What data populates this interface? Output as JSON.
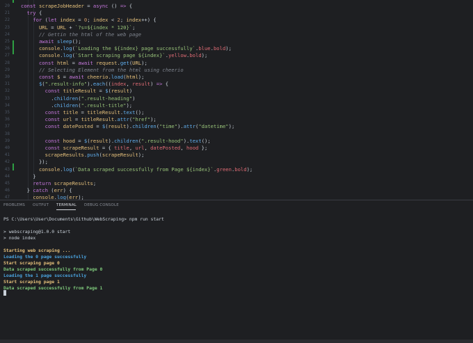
{
  "editor": {
    "lines": [
      {
        "num": "20",
        "tokens": [
          [
            "kw",
            "const "
          ],
          [
            "var",
            "scrapeJobHeader"
          ],
          [
            "pl",
            " = "
          ],
          [
            "kw",
            "async"
          ],
          [
            "pl",
            " () "
          ],
          [
            "kw",
            "=>"
          ],
          [
            "pl",
            " {"
          ]
        ]
      },
      {
        "num": "21",
        "tokens": [
          [
            "pl",
            "  "
          ],
          [
            "kw",
            "try"
          ],
          [
            "pl",
            " {"
          ]
        ]
      },
      {
        "num": "22",
        "tokens": [
          [
            "pl",
            "    "
          ],
          [
            "kw",
            "for"
          ],
          [
            "pl",
            " ("
          ],
          [
            "kw",
            "let "
          ],
          [
            "var",
            "index"
          ],
          [
            "pl",
            " = "
          ],
          [
            "num",
            "0"
          ],
          [
            "pl",
            "; "
          ],
          [
            "var",
            "index"
          ],
          [
            "pl",
            " < "
          ],
          [
            "num",
            "2"
          ],
          [
            "pl",
            "; "
          ],
          [
            "var",
            "index"
          ],
          [
            "pl",
            "++) {"
          ]
        ]
      },
      {
        "num": "23",
        "tokens": [
          [
            "pl",
            "      "
          ],
          [
            "var",
            "URL"
          ],
          [
            "pl",
            " = "
          ],
          [
            "var",
            "URL"
          ],
          [
            "pl",
            " + "
          ],
          [
            "str",
            "`?s=${index * 120}`"
          ],
          [
            "pl",
            ";"
          ]
        ]
      },
      {
        "num": "24",
        "tokens": [
          [
            "pl",
            "      "
          ],
          [
            "cm",
            "// Gettin the html of the web page"
          ]
        ]
      },
      {
        "num": "25",
        "tokens": [
          [
            "pl",
            "      "
          ],
          [
            "kw",
            "await "
          ],
          [
            "fn",
            "sleep"
          ],
          [
            "pl",
            "();"
          ]
        ]
      },
      {
        "num": "26",
        "tokens": [
          [
            "pl",
            "      "
          ],
          [
            "var",
            "console"
          ],
          [
            "pl",
            "."
          ],
          [
            "fn",
            "log"
          ],
          [
            "pl",
            "("
          ],
          [
            "str",
            "`Loading the ${index} page successfully`"
          ],
          [
            "pl",
            "."
          ],
          [
            "pr",
            "blue"
          ],
          [
            "pl",
            "."
          ],
          [
            "pr",
            "bold"
          ],
          [
            "pl",
            ");"
          ]
        ]
      },
      {
        "num": "27",
        "tokens": [
          [
            "pl",
            "      "
          ],
          [
            "var",
            "console"
          ],
          [
            "pl",
            "."
          ],
          [
            "fn",
            "log"
          ],
          [
            "pl",
            "("
          ],
          [
            "str",
            "`Start scraping page ${index}`"
          ],
          [
            "pl",
            "."
          ],
          [
            "pr",
            "yellow"
          ],
          [
            "pl",
            "."
          ],
          [
            "pr",
            "bold"
          ],
          [
            "pl",
            ");"
          ]
        ]
      },
      {
        "num": "28",
        "tokens": [
          [
            "pl",
            "      "
          ],
          [
            "kw",
            "const "
          ],
          [
            "var",
            "html"
          ],
          [
            "pl",
            " = "
          ],
          [
            "kw",
            "await "
          ],
          [
            "var",
            "request"
          ],
          [
            "pl",
            "."
          ],
          [
            "fn",
            "get"
          ],
          [
            "pl",
            "("
          ],
          [
            "var",
            "URL"
          ],
          [
            "pl",
            ");"
          ]
        ]
      },
      {
        "num": "29",
        "tokens": [
          [
            "pl",
            "      "
          ],
          [
            "cm",
            "// Selecting Element from the html using cheerio"
          ]
        ]
      },
      {
        "num": "30",
        "tokens": [
          [
            "pl",
            "      "
          ],
          [
            "kw",
            "const "
          ],
          [
            "var",
            "$"
          ],
          [
            "pl",
            " = "
          ],
          [
            "kw",
            "await "
          ],
          [
            "var",
            "cheerio"
          ],
          [
            "pl",
            "."
          ],
          [
            "fn",
            "load"
          ],
          [
            "pl",
            "("
          ],
          [
            "var",
            "html"
          ],
          [
            "pl",
            ");"
          ]
        ]
      },
      {
        "num": "31",
        "tokens": [
          [
            "pl",
            "      "
          ],
          [
            "fn",
            "$"
          ],
          [
            "pl",
            "("
          ],
          [
            "str",
            "\".result-info\""
          ],
          [
            "pl",
            ")."
          ],
          [
            "fn",
            "each"
          ],
          [
            "pl",
            "(("
          ],
          [
            "pr",
            "index"
          ],
          [
            "pl",
            ", "
          ],
          [
            "pr",
            "result"
          ],
          [
            "pl",
            ") "
          ],
          [
            "kw",
            "=>"
          ],
          [
            "pl",
            " {"
          ]
        ]
      },
      {
        "num": "32",
        "tokens": [
          [
            "pl",
            "        "
          ],
          [
            "kw",
            "const "
          ],
          [
            "var",
            "titleResult"
          ],
          [
            "pl",
            " = "
          ],
          [
            "fn",
            "$"
          ],
          [
            "pl",
            "("
          ],
          [
            "var",
            "result"
          ],
          [
            "pl",
            ")"
          ]
        ]
      },
      {
        "num": "33",
        "tokens": [
          [
            "pl",
            "          ."
          ],
          [
            "fn",
            "children"
          ],
          [
            "pl",
            "("
          ],
          [
            "str",
            "\".result-heading\""
          ],
          [
            "pl",
            ")"
          ]
        ]
      },
      {
        "num": "34",
        "tokens": [
          [
            "pl",
            "          ."
          ],
          [
            "fn",
            "children"
          ],
          [
            "pl",
            "("
          ],
          [
            "str",
            "\".result-title\""
          ],
          [
            "pl",
            ");"
          ]
        ]
      },
      {
        "num": "35",
        "tokens": [
          [
            "pl",
            "        "
          ],
          [
            "kw",
            "const "
          ],
          [
            "var",
            "title"
          ],
          [
            "pl",
            " = "
          ],
          [
            "var",
            "titleResult"
          ],
          [
            "pl",
            "."
          ],
          [
            "fn",
            "text"
          ],
          [
            "pl",
            "();"
          ]
        ]
      },
      {
        "num": "36",
        "tokens": [
          [
            "pl",
            "        "
          ],
          [
            "kw",
            "const "
          ],
          [
            "var",
            "url"
          ],
          [
            "pl",
            " = "
          ],
          [
            "var",
            "titleResult"
          ],
          [
            "pl",
            "."
          ],
          [
            "fn",
            "attr"
          ],
          [
            "pl",
            "("
          ],
          [
            "str",
            "\"href\""
          ],
          [
            "pl",
            ");"
          ]
        ]
      },
      {
        "num": "37",
        "tokens": [
          [
            "pl",
            "        "
          ],
          [
            "kw",
            "const "
          ],
          [
            "var",
            "datePosted"
          ],
          [
            "pl",
            " = "
          ],
          [
            "fn",
            "$"
          ],
          [
            "pl",
            "("
          ],
          [
            "var",
            "result"
          ],
          [
            "pl",
            ")."
          ],
          [
            "fn",
            "children"
          ],
          [
            "pl",
            "("
          ],
          [
            "str",
            "\"time\""
          ],
          [
            "pl",
            ")."
          ],
          [
            "fn",
            "attr"
          ],
          [
            "pl",
            "("
          ],
          [
            "str",
            "\"datetime\""
          ],
          [
            "pl",
            ");"
          ]
        ]
      },
      {
        "num": "38",
        "tokens": []
      },
      {
        "num": "39",
        "tokens": [
          [
            "pl",
            "        "
          ],
          [
            "kw",
            "const "
          ],
          [
            "var",
            "hood"
          ],
          [
            "pl",
            " = "
          ],
          [
            "fn",
            "$"
          ],
          [
            "pl",
            "("
          ],
          [
            "var",
            "result"
          ],
          [
            "pl",
            ")."
          ],
          [
            "fn",
            "children"
          ],
          [
            "pl",
            "("
          ],
          [
            "str",
            "\".result-hood\""
          ],
          [
            "pl",
            ")."
          ],
          [
            "fn",
            "text"
          ],
          [
            "pl",
            "();"
          ]
        ]
      },
      {
        "num": "40",
        "tokens": [
          [
            "pl",
            "        "
          ],
          [
            "kw",
            "const "
          ],
          [
            "var",
            "scrapeResult"
          ],
          [
            "pl",
            " = { "
          ],
          [
            "pr",
            "title"
          ],
          [
            "pl",
            ", "
          ],
          [
            "pr",
            "url"
          ],
          [
            "pl",
            ", "
          ],
          [
            "pr",
            "datePosted"
          ],
          [
            "pl",
            ", "
          ],
          [
            "pr",
            "hood"
          ],
          [
            "pl",
            " };"
          ]
        ]
      },
      {
        "num": "41",
        "tokens": [
          [
            "pl",
            "        "
          ],
          [
            "var",
            "scrapeResults"
          ],
          [
            "pl",
            "."
          ],
          [
            "fn",
            "push"
          ],
          [
            "pl",
            "("
          ],
          [
            "var",
            "scrapeResult"
          ],
          [
            "pl",
            ");"
          ]
        ]
      },
      {
        "num": "42",
        "tokens": [
          [
            "pl",
            "      });"
          ]
        ]
      },
      {
        "num": "43",
        "tokens": [
          [
            "pl",
            "      "
          ],
          [
            "var",
            "console"
          ],
          [
            "pl",
            "."
          ],
          [
            "fn",
            "log"
          ],
          [
            "pl",
            "("
          ],
          [
            "str",
            "`Data scraped successfully from Page ${index}`"
          ],
          [
            "pl",
            "."
          ],
          [
            "pr",
            "green"
          ],
          [
            "pl",
            "."
          ],
          [
            "pr",
            "bold"
          ],
          [
            "pl",
            ");"
          ]
        ]
      },
      {
        "num": "44",
        "tokens": [
          [
            "pl",
            "    }"
          ]
        ]
      },
      {
        "num": "45",
        "tokens": [
          [
            "pl",
            "    "
          ],
          [
            "kw",
            "return "
          ],
          [
            "var",
            "scrapeResults"
          ],
          [
            "pl",
            ";"
          ]
        ]
      },
      {
        "num": "46",
        "tokens": [
          [
            "pl",
            "  } "
          ],
          [
            "kw",
            "catch"
          ],
          [
            "pl",
            " ("
          ],
          [
            "var",
            "err"
          ],
          [
            "pl",
            ") {"
          ]
        ]
      },
      {
        "num": "47",
        "tokens": [
          [
            "pl",
            "    "
          ],
          [
            "var",
            "console"
          ],
          [
            "pl",
            "."
          ],
          [
            "fn",
            "log"
          ],
          [
            "pl",
            "("
          ],
          [
            "var",
            "err"
          ],
          [
            "pl",
            ");"
          ]
        ]
      }
    ]
  },
  "panel": {
    "tabs": [
      {
        "label": "PROBLEMS",
        "active": false
      },
      {
        "label": "OUTPUT",
        "active": false
      },
      {
        "label": "TERMINAL",
        "active": true
      },
      {
        "label": "DEBUG CONSOLE",
        "active": false
      }
    ]
  },
  "terminal": {
    "lines": [
      {
        "text": "PS C:\\Users\\User\\Documents\\Github\\WebScraping> npm run start",
        "style": "t-plain"
      },
      {
        "text": "",
        "style": "t-plain"
      },
      {
        "text": "> webscraping@1.0.0 start",
        "style": "t-plain"
      },
      {
        "text": "> node index",
        "style": "t-plain"
      },
      {
        "text": "",
        "style": "t-plain"
      },
      {
        "text": "Starting web scraping ...",
        "style": "t-yellow"
      },
      {
        "text": "Loading the 0 page successfully",
        "style": "t-blue"
      },
      {
        "text": "Start scraping page 0",
        "style": "t-yellow"
      },
      {
        "text": "Data scraped successfully from Page 0",
        "style": "t-green"
      },
      {
        "text": "Loading the 1 page successfully",
        "style": "t-blue"
      },
      {
        "text": "Start scraping page 1",
        "style": "t-yellow"
      },
      {
        "text": "Data scraped successfully from Page 1",
        "style": "t-green"
      }
    ]
  }
}
